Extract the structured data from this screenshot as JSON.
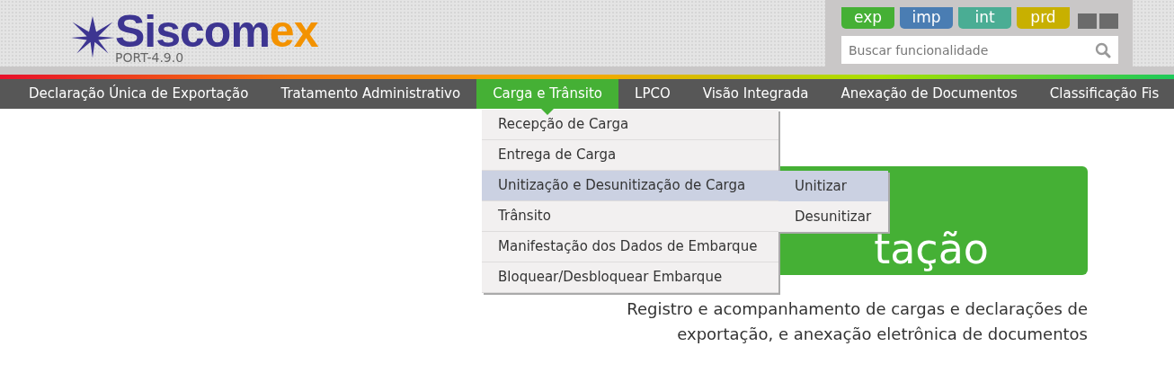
{
  "header": {
    "logo": {
      "name": "Siscom",
      "accent": "ex",
      "version": "PORT-4.9.0"
    },
    "environments": [
      {
        "label": "exp",
        "color": "#45b035"
      },
      {
        "label": "imp",
        "color": "#4a7db3"
      },
      {
        "label": "int",
        "color": "#4aad94"
      },
      {
        "label": "prd",
        "color": "#c8b000"
      }
    ],
    "search": {
      "placeholder": "Buscar funcionalidade"
    }
  },
  "nav": {
    "items": [
      {
        "label": "Declaração Única de Exportação",
        "selected": false
      },
      {
        "label": "Tratamento Administrativo",
        "selected": false
      },
      {
        "label": "Carga e Trânsito",
        "selected": true
      },
      {
        "label": "LPCO",
        "selected": false
      },
      {
        "label": "Visão Integrada",
        "selected": false
      },
      {
        "label": "Anexação de Documentos",
        "selected": false
      },
      {
        "label": "Classificação Fis",
        "selected": false
      }
    ]
  },
  "dropdown": {
    "items": [
      {
        "label": "Recepção de Carga",
        "selected": false
      },
      {
        "label": "Entrega de Carga",
        "selected": false
      },
      {
        "label": "Unitização e Desunitização de Carga",
        "selected": true,
        "children": [
          {
            "label": "Unitizar",
            "selected": true
          },
          {
            "label": "Desunitizar",
            "selected": false
          }
        ]
      },
      {
        "label": "Trânsito",
        "selected": false
      },
      {
        "label": "Manifestação dos Dados de Embarque",
        "selected": false
      },
      {
        "label": "Bloquear/Desbloquear Embarque",
        "selected": false
      }
    ]
  },
  "hero": {
    "title": "tação",
    "description": "Registro e acompanhamento de cargas e declarações de exportação, e anexação eletrônica de documentos"
  }
}
